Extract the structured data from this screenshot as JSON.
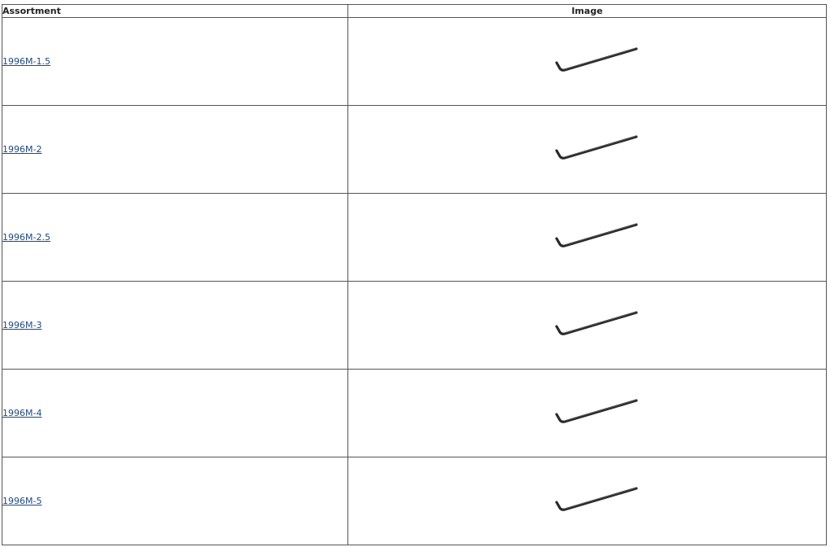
{
  "table": {
    "headers": {
      "assortment": "Assortment",
      "image": "Image"
    },
    "rows": [
      {
        "assortment": "1996M-1.5",
        "image_icon": "hex-key-icon"
      },
      {
        "assortment": "1996M-2",
        "image_icon": "hex-key-icon"
      },
      {
        "assortment": "1996M-2.5",
        "image_icon": "hex-key-icon"
      },
      {
        "assortment": "1996M-3",
        "image_icon": "hex-key-icon"
      },
      {
        "assortment": "1996M-4",
        "image_icon": "hex-key-icon"
      },
      {
        "assortment": "1996M-5",
        "image_icon": "hex-key-icon"
      }
    ]
  },
  "colors": {
    "link": "#1d4a86",
    "border": "#555555",
    "tool": "#2a2a2a"
  }
}
